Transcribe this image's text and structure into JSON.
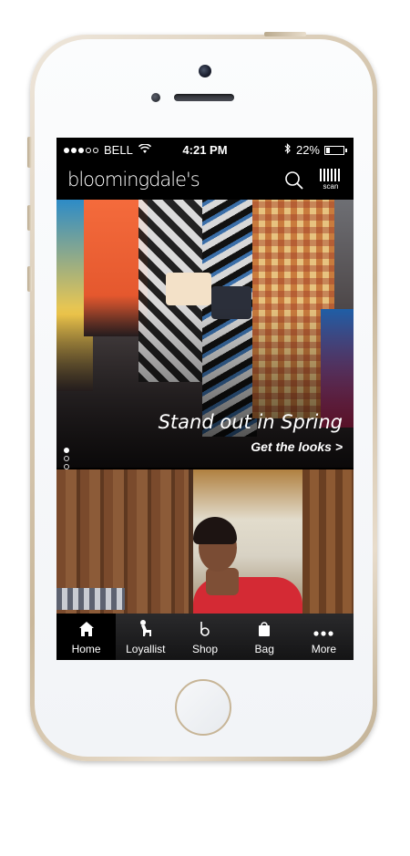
{
  "status_bar": {
    "carrier": "BELL",
    "time": "4:21 PM",
    "battery": "22%",
    "battery_level": 0.22,
    "signal_bars_filled": 3,
    "signal_bars_total": 5
  },
  "app_bar": {
    "logo": "bloomingdale's",
    "search_icon": "search-icon",
    "scan_label": "scan"
  },
  "hero": {
    "headline": "Stand out in Spring",
    "cta": "Get the looks >",
    "pager_total": 4,
    "pager_active": 1
  },
  "tab_bar": {
    "items": [
      {
        "label": "Home",
        "icon": "home-icon",
        "active": true
      },
      {
        "label": "Loyallist",
        "icon": "dog-icon",
        "active": false
      },
      {
        "label": "Shop",
        "icon": "b-logo-icon",
        "active": false
      },
      {
        "label": "Bag",
        "icon": "bag-icon",
        "active": false
      },
      {
        "label": "More",
        "icon": "more-icon",
        "active": false
      }
    ]
  },
  "colors": {
    "phone_trim": "#c9b79a",
    "screen_bg": "#000000",
    "text": "#ffffff"
  }
}
